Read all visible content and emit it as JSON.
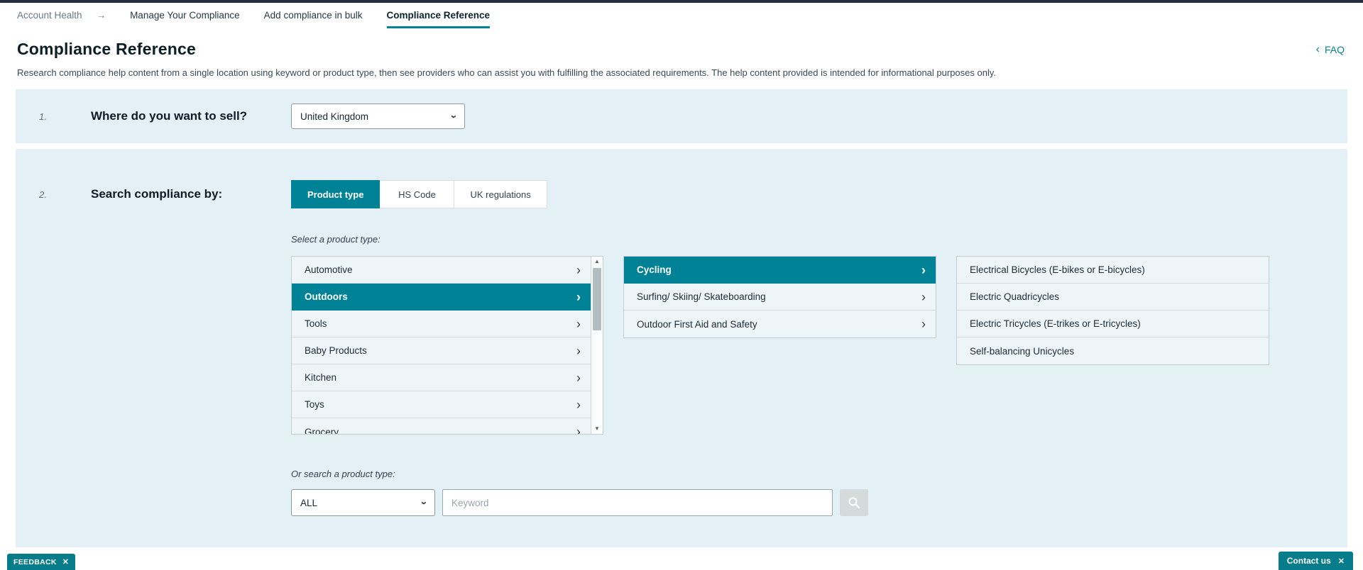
{
  "icons": {
    "arrow_right": "→",
    "chevron_left": "‹",
    "chevron_right": "›",
    "close": "✕",
    "scroll_up": "▲",
    "scroll_down": "▼"
  },
  "colors": {
    "accent_teal": "#008296",
    "panel_background": "#e3f0f5",
    "list_row_background": "#eef5f9",
    "top_bar": "#232f3e"
  },
  "topnav": {
    "root": "Account Health",
    "items": [
      {
        "label": "Manage Your Compliance"
      },
      {
        "label": "Add compliance in bulk"
      },
      {
        "label": "Compliance Reference"
      }
    ]
  },
  "header": {
    "title": "Compliance Reference",
    "faq_label": "FAQ"
  },
  "description": "Research compliance help content from a single location using keyword or product type, then see providers who can assist you with fulfilling the associated requirements. The help content provided is intended for informational purposes only.",
  "step1": {
    "number": "1.",
    "label": "Where do you want to sell?",
    "selected_country": "United Kingdom"
  },
  "step2": {
    "number": "2.",
    "label": "Search compliance by:",
    "tabs": [
      {
        "label": "Product type",
        "active": true
      },
      {
        "label": "HS Code",
        "active": false
      },
      {
        "label": "UK regulations",
        "active": false
      }
    ],
    "select_product_label": "Select a product type:",
    "categories": [
      {
        "label": "Automotive",
        "selected": false
      },
      {
        "label": "Outdoors",
        "selected": true
      },
      {
        "label": "Tools",
        "selected": false
      },
      {
        "label": "Baby Products",
        "selected": false
      },
      {
        "label": "Kitchen",
        "selected": false
      },
      {
        "label": "Toys",
        "selected": false
      },
      {
        "label": "Grocery",
        "selected": false
      }
    ],
    "subcategories": [
      {
        "label": "Cycling",
        "selected": true
      },
      {
        "label": "Surfing/ Skiing/ Skateboarding",
        "selected": false
      },
      {
        "label": "Outdoor First Aid and Safety",
        "selected": false
      }
    ],
    "products": [
      {
        "label": "Electrical Bicycles (E-bikes or E-bicycles)"
      },
      {
        "label": "Electric Quadricycles"
      },
      {
        "label": "Electric Tricycles (E-trikes or E-tricycles)"
      },
      {
        "label": "Self-balancing Unicycles"
      }
    ],
    "or_search_label": "Or search a product type:",
    "filter_selected": "ALL",
    "keyword_placeholder": "Keyword"
  },
  "badges": {
    "feedback": "FEEDBACK",
    "contact": "Contact us"
  }
}
